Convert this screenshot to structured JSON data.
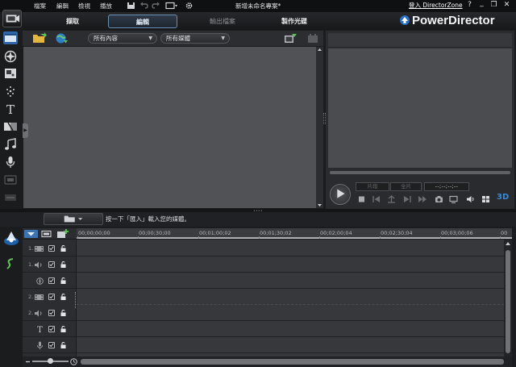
{
  "menu": {
    "items": [
      "檔案",
      "編輯",
      "檢視",
      "播放"
    ],
    "project_title": "新增未命名專案*",
    "login_link": "登入 DirectorZone",
    "window_controls": [
      "?",
      "_",
      "❐",
      "✕"
    ]
  },
  "modes": {
    "capture": "擷取",
    "edit": "編輯",
    "produce": "輸出檔案",
    "disc": "製作光碟"
  },
  "brand": "PowerDirector",
  "library": {
    "filter_content": "所有內容",
    "filter_media": "所有媒體"
  },
  "preview": {
    "segment_label": "片段",
    "full_label": "全片",
    "timecode": "--;--;--;--",
    "badge_3d": "3D"
  },
  "hint_text": "按一下「匯入」載入您的媒體。",
  "timeline": {
    "ruler": [
      "00;00;00;00",
      "00;00;30;00",
      "00;01;00;02",
      "00;01;30;02",
      "00;02;00;04",
      "00;02;30;04",
      "00;03;00;06",
      "00"
    ],
    "track_numbers": [
      "1.",
      "1.",
      "2.",
      "2."
    ]
  },
  "colors": {
    "accent": "#2a6fc4",
    "background": "#1b1c1e",
    "panel": "#505256",
    "timeline_track": "#36383b"
  },
  "icons": {
    "sidebar": [
      "media-room-icon",
      "effect-room-icon",
      "pip-room-icon",
      "particle-room-icon",
      "title-room-icon",
      "transition-room-icon",
      "audio-mixing-icon",
      "voice-over-icon",
      "chapter-room-icon",
      "subtitle-room-icon"
    ],
    "timeline_left": [
      "magic-tool-icon",
      "fix-enhance-icon"
    ]
  }
}
